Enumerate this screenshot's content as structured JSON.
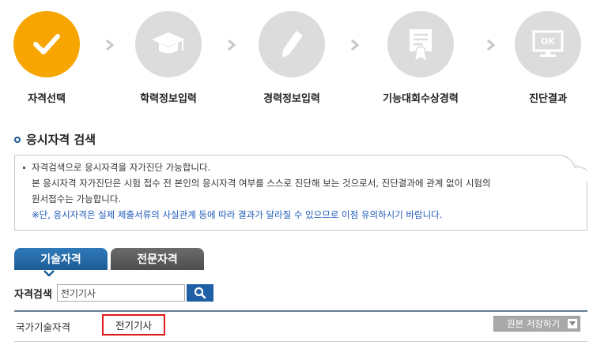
{
  "steps": [
    {
      "label": "자격선택",
      "icon": "check-icon",
      "active": true
    },
    {
      "label": "학력정보입력",
      "icon": "graduation-cap-icon",
      "active": false
    },
    {
      "label": "경력정보입력",
      "icon": "pencil-icon",
      "active": false
    },
    {
      "label": "기능대회수상경력",
      "icon": "certificate-icon",
      "active": false
    },
    {
      "label": "진단결과",
      "icon": "monitor-ok-icon",
      "active": false
    }
  ],
  "step_result_icon_text": "OK",
  "section": {
    "title": "응시자격 검색"
  },
  "notice": {
    "line1": "자격검색으로 응시자격을 자가진단 가능합니다.",
    "line2": "본 응시자격 자가진단은 시험 접수 전 본인의 응시자격 여부를 스스로 진단해 보는 것으로서, 진단결과에 관계 없이 시험의",
    "line3": "원서접수는 가능합니다.",
    "line4": "※단, 응시자격은 실제 제출서류의 사실관계 등에 따라 결과가 달라질 수 있으므로 이점 유의하시기 바랍니다."
  },
  "tabs": [
    {
      "label": "기술자격",
      "active": true
    },
    {
      "label": "전문자격",
      "active": false
    }
  ],
  "search": {
    "label": "자격검색",
    "value": "전기기사",
    "button_icon": "search-icon"
  },
  "result": {
    "category": "국가기술자격",
    "item": "전기기사",
    "save_button": "원본 저장하기"
  },
  "colors": {
    "active_step": "#f7a500",
    "inactive_step": "#dcdcdc",
    "tab_active": "#1d5d97",
    "tab_inactive": "#555555",
    "highlight": "#e01b1b",
    "notice_blue": "#1d58b8"
  }
}
